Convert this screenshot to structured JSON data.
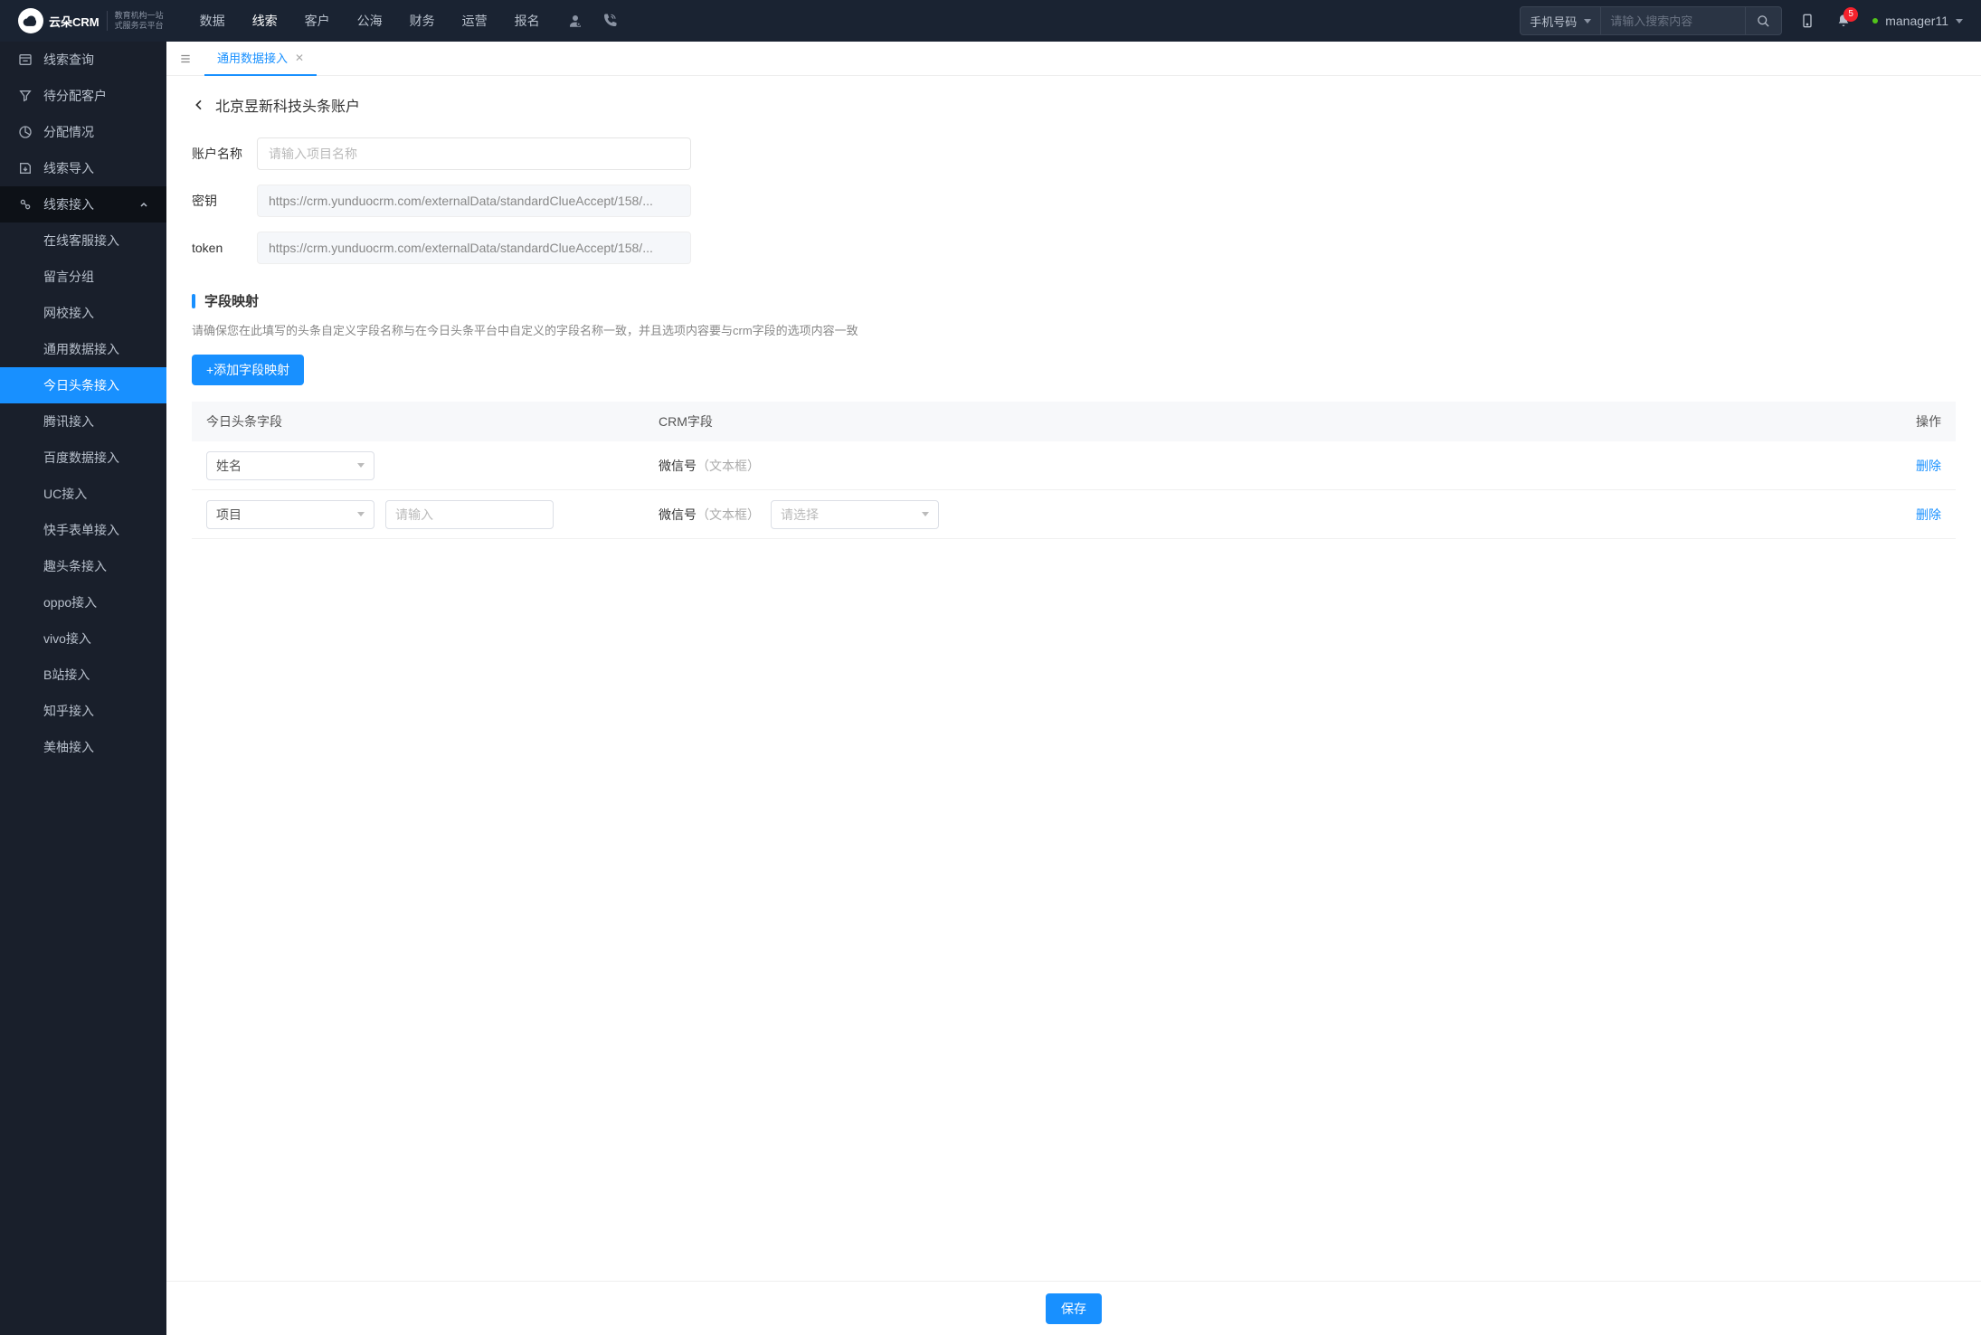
{
  "header": {
    "brand": "云朵CRM",
    "brand_sub1": "教育机构一站",
    "brand_sub2": "式服务云平台",
    "nav": [
      "数据",
      "线索",
      "客户",
      "公海",
      "财务",
      "运营",
      "报名"
    ],
    "nav_active": 1,
    "search_select": "手机号码",
    "search_placeholder": "请输入搜索内容",
    "badge": "5",
    "user": "manager11"
  },
  "sidebar": {
    "items": [
      {
        "label": "线索查询"
      },
      {
        "label": "待分配客户"
      },
      {
        "label": "分配情况"
      },
      {
        "label": "线索导入"
      },
      {
        "label": "线索接入",
        "expanded": true
      }
    ],
    "subitems": [
      "在线客服接入",
      "留言分组",
      "网校接入",
      "通用数据接入",
      "今日头条接入",
      "腾讯接入",
      "百度数据接入",
      "UC接入",
      "快手表单接入",
      "趣头条接入",
      "oppo接入",
      "vivo接入",
      "B站接入",
      "知乎接入",
      "美柚接入"
    ],
    "sub_active": 4
  },
  "tabs": {
    "active": "通用数据接入"
  },
  "page": {
    "breadcrumb": "北京昱新科技头条账户",
    "form": {
      "name_label": "账户名称",
      "name_placeholder": "请输入项目名称",
      "secret_label": "密钥",
      "secret_value": "https://crm.yunduocrm.com/externalData/standardClueAccept/158/...",
      "token_label": "token",
      "token_value": "https://crm.yunduocrm.com/externalData/standardClueAccept/158/..."
    },
    "mapping": {
      "title": "字段映射",
      "desc": "请确保您在此填写的头条自定义字段名称与在今日头条平台中自定义的字段名称一致，并且选项内容要与crm字段的选项内容一致",
      "add_btn": "+添加字段映射",
      "headers": {
        "col1": "今日头条字段",
        "col2": "CRM字段",
        "col3": "操作"
      },
      "rows": [
        {
          "field": "姓名",
          "crm": "微信号",
          "crm_hint": "（文本框）",
          "extra_input": false,
          "extra_select": false
        },
        {
          "field": "项目",
          "crm": "微信号",
          "crm_hint": "（文本框）",
          "extra_input": true,
          "input_placeholder": "请输入",
          "extra_select": true,
          "select_placeholder": "请选择"
        }
      ],
      "delete": "删除"
    },
    "save": "保存"
  }
}
